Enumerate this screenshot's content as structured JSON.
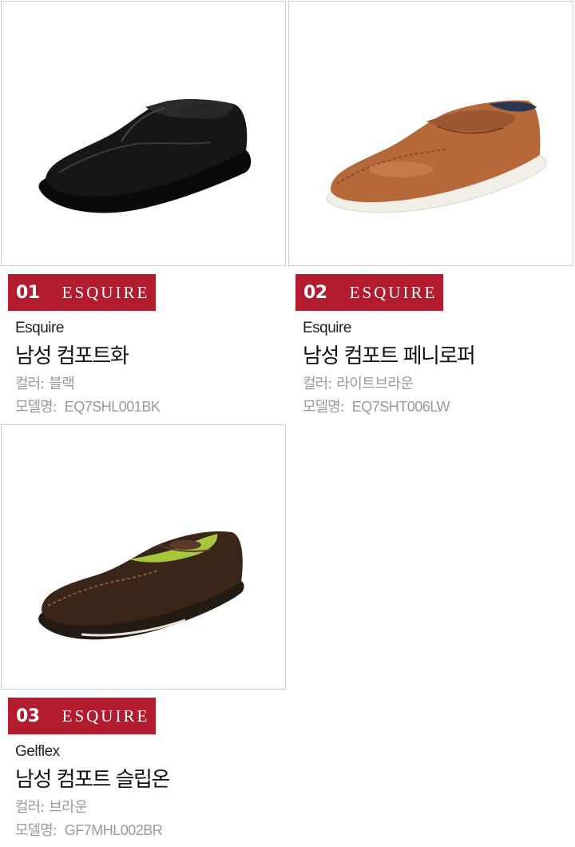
{
  "products": [
    {
      "number": "01",
      "brand_logo": "ESQUIRE",
      "brand": "Esquire",
      "name": "남성 컴포트화",
      "color_label": "컬러:",
      "color_value": "블랙",
      "model_label": "모델명:",
      "model_value": "EQ7SHL001BK",
      "shoe_colors": {
        "upper": "#161616",
        "sole": "#0a0a0a",
        "highlight": "#3a3a3a"
      }
    },
    {
      "number": "02",
      "brand_logo": "ESQUIRE",
      "brand": "Esquire",
      "name": "남성 컴포트 페니로퍼",
      "color_label": "컬러:",
      "color_value": "라이트브라운",
      "model_label": "모델명:",
      "model_value": "EQ7SHT006LW",
      "shoe_colors": {
        "upper": "#b5683a",
        "sole": "#f2efe9",
        "highlight": "#d48a55"
      }
    },
    {
      "number": "03",
      "brand_logo": "ESQUIRE",
      "brand": "Gelflex",
      "name": "남성 컴포트 슬립온",
      "color_label": "컬러:",
      "color_value": "브라운",
      "model_label": "모델명:",
      "model_value": "GF7MHL002BR",
      "shoe_colors": {
        "upper": "#3b2418",
        "sole": "#241a14",
        "highlight": "#5a3a28"
      }
    }
  ],
  "accent_color": "#b31b2e"
}
